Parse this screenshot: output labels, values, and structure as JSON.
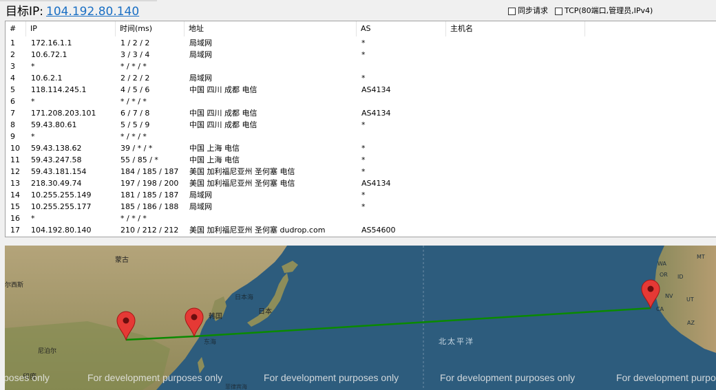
{
  "header": {
    "target_label": "目标IP:",
    "target_ip": "104.192.80.140",
    "option_sync": "同步请求",
    "option_tcp": "TCP(80端口,管理员,IPv4)"
  },
  "table": {
    "columns": [
      "#",
      "IP",
      "时间(ms)",
      "地址",
      "AS",
      "主机名"
    ],
    "rows": [
      [
        "1",
        "172.16.1.1",
        "1 / 2 / 2",
        "局域网",
        "*"
      ],
      [
        "2",
        "10.6.72.1",
        "3 / 3 / 4",
        "局域网",
        "*"
      ],
      [
        "3",
        "*",
        "* / * / *",
        "",
        ""
      ],
      [
        "4",
        "10.6.2.1",
        "2 / 2 / 2",
        "局域网",
        "*"
      ],
      [
        "5",
        "118.114.245.1",
        "4 / 5 / 6",
        "中国 四川 成都 电信",
        "AS4134"
      ],
      [
        "6",
        "*",
        "* / * / *",
        "",
        ""
      ],
      [
        "7",
        "171.208.203.101",
        "6 / 7 / 8",
        "中国 四川 成都 电信",
        "AS4134"
      ],
      [
        "8",
        "59.43.80.61",
        "5 / 5 / 9",
        "中国 四川 成都 电信",
        "*"
      ],
      [
        "9",
        "*",
        "* / * / *",
        "",
        ""
      ],
      [
        "10",
        "59.43.138.62",
        "39 / * / *",
        "中国 上海 电信",
        "*"
      ],
      [
        "11",
        "59.43.247.58",
        "55 / 85 / *",
        "中国 上海 电信",
        "*"
      ],
      [
        "12",
        "59.43.181.154",
        "184 / 185 / 187",
        "美国 加利福尼亚州 圣何塞 电信",
        "*"
      ],
      [
        "13",
        "218.30.49.74",
        "197 / 198 / 200",
        "美国 加利福尼亚州 圣何塞 电信",
        "AS4134"
      ],
      [
        "14",
        "10.255.255.149",
        "181 / 185 / 187",
        "局域网",
        "*"
      ],
      [
        "15",
        "10.255.255.177",
        "185 / 186 / 188",
        "局域网",
        "*"
      ],
      [
        "16",
        "*",
        "* / * / *",
        "",
        ""
      ],
      [
        "17",
        "104.192.80.140",
        "210 / 212 / 212",
        "美国 加利福尼亚州 圣何塞 dudrop.com",
        "AS54600"
      ]
    ]
  },
  "map": {
    "labels": {
      "mongolia": "蒙古",
      "west_edge": "尔西斯",
      "nepal": "尼泊尔",
      "india": "印度",
      "japan": "日本",
      "sea_of_japan": "日本海",
      "korea": "韩国",
      "east_sea": "东海",
      "north_pacific": "北太平洋",
      "bottom_partial": "菲律宾海",
      "mt": "MT",
      "or": "OR",
      "id": "ID",
      "nv": "NV",
      "ut": "UT",
      "ca": "CA",
      "az": "AZ",
      "wa": "WA"
    },
    "watermark": "For development purposes only",
    "watermark_partial": "poses only",
    "route_color": "#0a8a00",
    "marker_color": "#e53935"
  }
}
